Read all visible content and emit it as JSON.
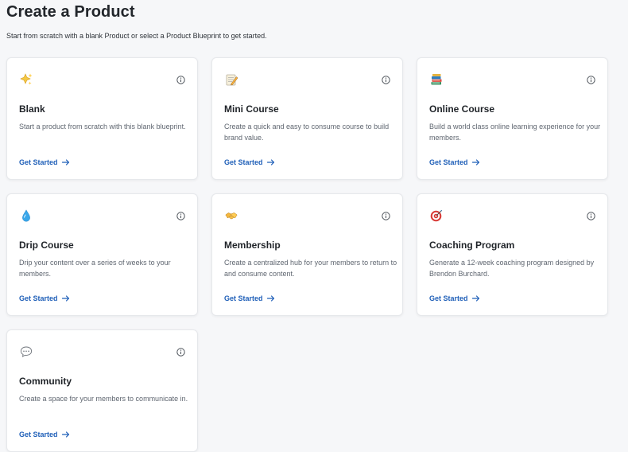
{
  "page": {
    "title": "Create a Product",
    "subtitle": "Start from scratch with a blank Product or select a Product Blueprint to get started."
  },
  "cards": [
    {
      "title": "Blank",
      "description": "Start a product from scratch with this blank blueprint.",
      "cta": "Get Started",
      "icon": "sparkles-icon"
    },
    {
      "title": "Mini Course",
      "description": "Create a quick and easy to consume course to build brand value.",
      "cta": "Get Started",
      "icon": "memo-icon"
    },
    {
      "title": "Online Course",
      "description": "Build a world class online learning experience for your members.",
      "cta": "Get Started",
      "icon": "books-icon"
    },
    {
      "title": "Drip Course",
      "description": "Drip your content over a series of weeks to your members.",
      "cta": "Get Started",
      "icon": "droplet-icon"
    },
    {
      "title": "Membership",
      "description": "Create a centralized hub for your members to return to and consume content.",
      "cta": "Get Started",
      "icon": "handshake-icon"
    },
    {
      "title": "Coaching Program",
      "description": "Generate a 12-week coaching program designed by Brendon Burchard.",
      "cta": "Get Started",
      "icon": "target-icon"
    },
    {
      "title": "Community",
      "description": "Create a space for your members to communicate in.",
      "cta": "Get Started",
      "icon": "speech-bubble-icon"
    }
  ],
  "colors": {
    "background": "#f6f7f9",
    "card": "#ffffff",
    "link": "#1f5fb8",
    "title": "#1f2328",
    "description": "#5f6670"
  }
}
